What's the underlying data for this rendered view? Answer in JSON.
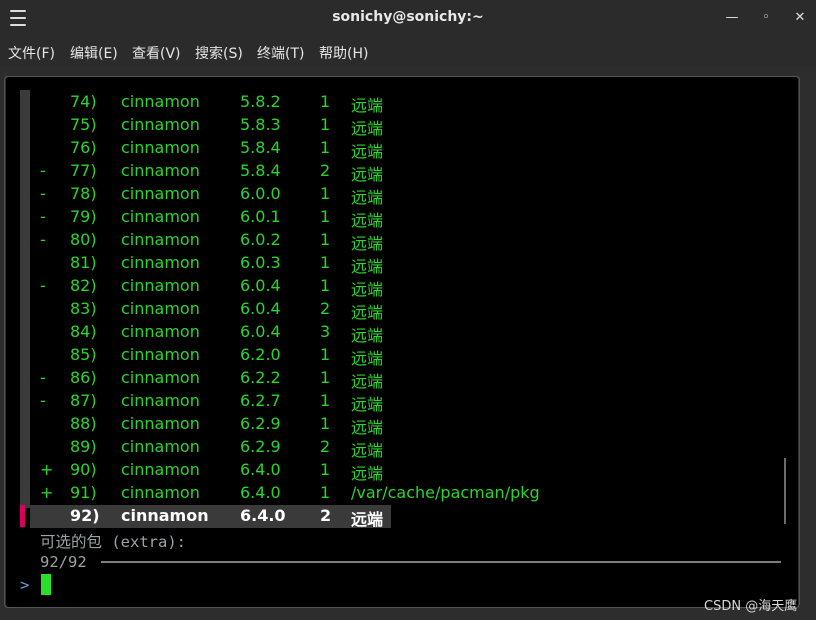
{
  "window": {
    "title": "sonichy@sonichy:~"
  },
  "menu": {
    "file": "文件(F)",
    "edit": "编辑(E)",
    "view": "查看(V)",
    "search": "搜索(S)",
    "terminal": "终端(T)",
    "help": "帮助(H)"
  },
  "terminal": {
    "rows": [
      {
        "mark": "",
        "num": "74)",
        "name": "cinnamon",
        "ver": "5.8.2",
        "cnt": "1",
        "repo": "远端"
      },
      {
        "mark": "",
        "num": "75)",
        "name": "cinnamon",
        "ver": "5.8.3",
        "cnt": "1",
        "repo": "远端"
      },
      {
        "mark": "",
        "num": "76)",
        "name": "cinnamon",
        "ver": "5.8.4",
        "cnt": "1",
        "repo": "远端"
      },
      {
        "mark": "-",
        "num": "77)",
        "name": "cinnamon",
        "ver": "5.8.4",
        "cnt": "2",
        "repo": "远端"
      },
      {
        "mark": "-",
        "num": "78)",
        "name": "cinnamon",
        "ver": "6.0.0",
        "cnt": "1",
        "repo": "远端"
      },
      {
        "mark": "-",
        "num": "79)",
        "name": "cinnamon",
        "ver": "6.0.1",
        "cnt": "1",
        "repo": "远端"
      },
      {
        "mark": "-",
        "num": "80)",
        "name": "cinnamon",
        "ver": "6.0.2",
        "cnt": "1",
        "repo": "远端"
      },
      {
        "mark": "",
        "num": "81)",
        "name": "cinnamon",
        "ver": "6.0.3",
        "cnt": "1",
        "repo": "远端"
      },
      {
        "mark": "-",
        "num": "82)",
        "name": "cinnamon",
        "ver": "6.0.4",
        "cnt": "1",
        "repo": "远端"
      },
      {
        "mark": "",
        "num": "83)",
        "name": "cinnamon",
        "ver": "6.0.4",
        "cnt": "2",
        "repo": "远端"
      },
      {
        "mark": "",
        "num": "84)",
        "name": "cinnamon",
        "ver": "6.0.4",
        "cnt": "3",
        "repo": "远端"
      },
      {
        "mark": "",
        "num": "85)",
        "name": "cinnamon",
        "ver": "6.2.0",
        "cnt": "1",
        "repo": "远端"
      },
      {
        "mark": "-",
        "num": "86)",
        "name": "cinnamon",
        "ver": "6.2.2",
        "cnt": "1",
        "repo": "远端"
      },
      {
        "mark": "-",
        "num": "87)",
        "name": "cinnamon",
        "ver": "6.2.7",
        "cnt": "1",
        "repo": "远端"
      },
      {
        "mark": "",
        "num": "88)",
        "name": "cinnamon",
        "ver": "6.2.9",
        "cnt": "1",
        "repo": "远端"
      },
      {
        "mark": "",
        "num": "89)",
        "name": "cinnamon",
        "ver": "6.2.9",
        "cnt": "2",
        "repo": "远端"
      },
      {
        "mark": "+",
        "num": "90)",
        "name": "cinnamon",
        "ver": "6.4.0",
        "cnt": "1",
        "repo": "远端"
      },
      {
        "mark": "+",
        "num": "91)",
        "name": "cinnamon",
        "ver": "6.4.0",
        "cnt": "1",
        "repo": "/var/cache/pacman/pkg"
      },
      {
        "mark": "",
        "num": "92)",
        "name": "cinnamon",
        "ver": "6.4.0",
        "cnt": "2",
        "repo": "远端"
      }
    ],
    "optional_label": "可选的包 (extra):",
    "count": "92/92",
    "prompt_caret": ">"
  },
  "watermark": "CSDN @海天鹰",
  "colors": {
    "entry_text": "#2ad62a",
    "selected_marker": "#d7005f",
    "cursor": "#27e027"
  }
}
